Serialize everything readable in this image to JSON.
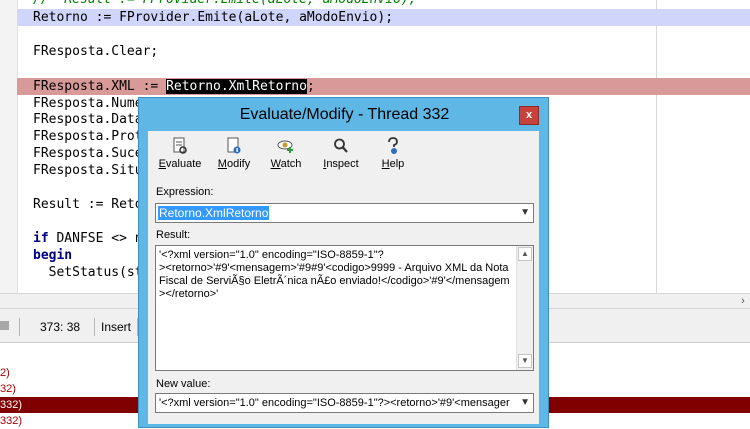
{
  "editor": {
    "lines": [
      {
        "text": "//  Result := FProvider.Emite(aLote, aModoEnvio);",
        "style": "comment",
        "hl": ""
      },
      {
        "text": "Retorno := FProvider.Emite(aLote, aModoEnvio);",
        "style": "",
        "hl": "blue"
      },
      {
        "text": "",
        "style": "",
        "hl": ""
      },
      {
        "text": "FResposta.Clear;",
        "style": "",
        "hl": ""
      },
      {
        "text": "",
        "style": "",
        "hl": ""
      },
      {
        "text": "FResposta.XML := ",
        "sel": "Retorno.XmlRetorno",
        "after": ";",
        "style": "",
        "hl": "red"
      },
      {
        "text": "FResposta.Numero",
        "style": "",
        "hl": ""
      },
      {
        "text": "FResposta.Data",
        "style": "",
        "hl": ""
      },
      {
        "text": "FResposta.Prot",
        "style": "",
        "hl": ""
      },
      {
        "text": "FResposta.Suce",
        "style": "",
        "hl": ""
      },
      {
        "text": "FResposta.Situ",
        "style": "",
        "hl": ""
      },
      {
        "text": "",
        "style": "",
        "hl": ""
      },
      {
        "text": "Result := Reto",
        "style": "",
        "hl": ""
      },
      {
        "text": "",
        "style": "",
        "hl": ""
      },
      {
        "text": "if DANFSE <> n",
        "style": "",
        "hl": ""
      },
      {
        "text": "begin",
        "style": "kw",
        "hl": ""
      },
      {
        "text": "  SetStatus(st",
        "style": "",
        "hl": ""
      }
    ]
  },
  "statusbar": {
    "position": "373: 38",
    "mode": "Insert"
  },
  "bottom_panel": {
    "lines": [
      "2)",
      "32)",
      "332)",
      "332)"
    ]
  },
  "dialog": {
    "title": "Evaluate/Modify - Thread 332",
    "close_glyph": "x",
    "toolbar": [
      {
        "label": "Evaluate",
        "icon": "evaluate-icon",
        "underline": "E",
        "rest": "valuate"
      },
      {
        "label": "Modify",
        "icon": "modify-icon",
        "underline": "M",
        "rest": "odify"
      },
      {
        "label": "Watch",
        "icon": "watch-icon",
        "underline": "W",
        "rest": "atch"
      },
      {
        "label": "Inspect",
        "icon": "inspect-icon",
        "underline": "I",
        "rest": "nspect"
      },
      {
        "label": "Help",
        "icon": "help-icon",
        "underline": "H",
        "rest": "elp"
      }
    ],
    "expression_label": "Expression:",
    "expression_value": "Retorno.XmlRetorno",
    "result_label": "Result:",
    "result_text": "'<?xml version=\"1.0\" encoding=\"ISO-8859-1\"?\n><retorno>'#9'<mensagem>'#9#9'<codigo>9999 - Arquivo XML da Nota Fiscal de ServiÃ§o EletrÃ´nica nÃ£o enviado!</codigo>'#9'</mensagem></retorno>'",
    "new_value_label": "New value:",
    "new_value": "'<?xml version=\"1.0\" encoding=\"ISO-8859-1\"?><retorno>'#9'<mensager"
  },
  "colors": {
    "dialog_frame": "#5fb7e6",
    "close_button": "#c7423a",
    "line_highlight_blue": "#cfd5fb",
    "line_highlight_red": "#d79a99",
    "selection": "#3399ff"
  }
}
